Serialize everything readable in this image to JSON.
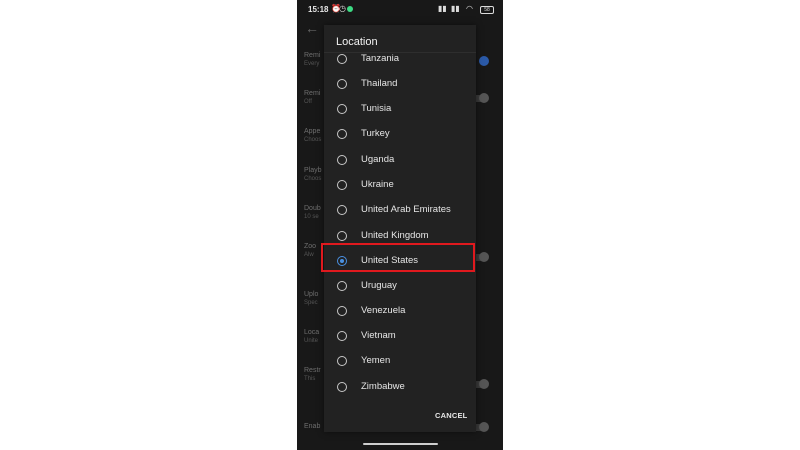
{
  "status_bar": {
    "time": "15:18",
    "battery": "58"
  },
  "dialog": {
    "title": "Location",
    "options": [
      {
        "label": "Tanzania",
        "selected": false
      },
      {
        "label": "Thailand",
        "selected": false
      },
      {
        "label": "Tunisia",
        "selected": false
      },
      {
        "label": "Turkey",
        "selected": false
      },
      {
        "label": "Uganda",
        "selected": false
      },
      {
        "label": "Ukraine",
        "selected": false
      },
      {
        "label": "United Arab Emirates",
        "selected": false
      },
      {
        "label": "United Kingdom",
        "selected": false
      },
      {
        "label": "United States",
        "selected": true
      },
      {
        "label": "Uruguay",
        "selected": false
      },
      {
        "label": "Venezuela",
        "selected": false
      },
      {
        "label": "Vietnam",
        "selected": false
      },
      {
        "label": "Yemen",
        "selected": false
      },
      {
        "label": "Zimbabwe",
        "selected": false
      }
    ],
    "cancel_label": "CANCEL"
  },
  "background_settings": [
    {
      "title": "Remi",
      "sub": "Every"
    },
    {
      "title": "Remi",
      "sub": "Off"
    },
    {
      "title": "Appe",
      "sub": "Choos"
    },
    {
      "title": "Playb",
      "sub": "Choos"
    },
    {
      "title": "Doub",
      "sub": "10 se"
    },
    {
      "title": "Zoo",
      "sub": "Alw"
    },
    {
      "title": "Uplo",
      "sub": "Spec"
    },
    {
      "title": "Loca",
      "sub": "Unite"
    },
    {
      "title": "Restr",
      "sub": "This"
    },
    {
      "title": "Enab",
      "sub": ""
    }
  ],
  "colors": {
    "accent": "#4a90e2",
    "highlight_box": "#e0191e",
    "dialog_bg": "#222222"
  }
}
